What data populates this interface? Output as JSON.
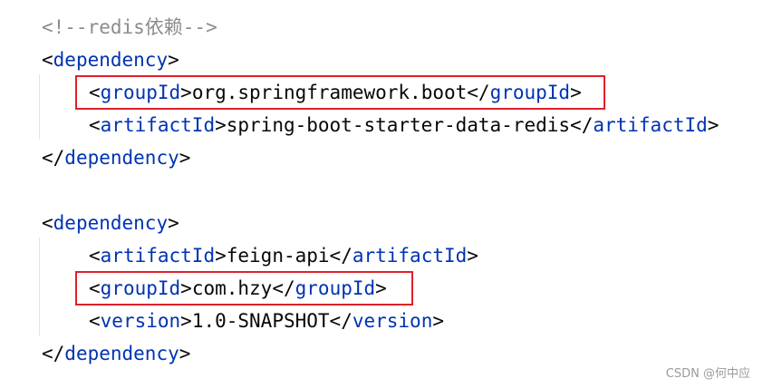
{
  "code": {
    "comment": "<!--redis依赖-->",
    "blocks": [
      {
        "open": {
          "lt": "<",
          "tag": "dependency",
          "gt": ">"
        },
        "children": [
          {
            "open_tag": "groupId",
            "value": "org.springframework.boot",
            "close_tag": "groupId"
          },
          {
            "open_tag": "artifactId",
            "value": "spring-boot-starter-data-redis",
            "close_tag": "artifactId"
          }
        ],
        "close": {
          "lt": "</",
          "tag": "dependency",
          "gt": ">"
        }
      },
      {
        "open": {
          "lt": "<",
          "tag": "dependency",
          "gt": ">"
        },
        "children": [
          {
            "open_tag": "artifactId",
            "value": "feign-api",
            "close_tag": "artifactId"
          },
          {
            "open_tag": "groupId",
            "value": "com.hzy",
            "close_tag": "groupId"
          },
          {
            "open_tag": "version",
            "value": "1.0-SNAPSHOT",
            "close_tag": "version"
          }
        ],
        "close": {
          "lt": "</",
          "tag": "dependency",
          "gt": ">"
        }
      }
    ]
  },
  "highlight_color": "#e0202a",
  "watermark": "CSDN @何中应"
}
